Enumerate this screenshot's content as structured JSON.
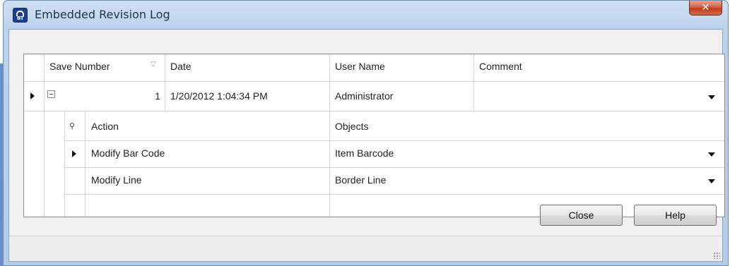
{
  "window": {
    "title": "Embedded Revision Log",
    "icon_text": "BT"
  },
  "grid": {
    "columns": [
      "Save Number",
      "Date",
      "User Name",
      "Comment"
    ],
    "row": {
      "save_number": "1",
      "date": "1/20/2012 1:04:34 PM",
      "user_name": "Administrator",
      "comment": ""
    },
    "detail": {
      "columns": [
        "Action",
        "Objects"
      ],
      "rows": [
        {
          "action": "Modify Bar Code",
          "objects": "Item Barcode"
        },
        {
          "action": "Modify Line",
          "objects": "Border Line"
        }
      ]
    }
  },
  "buttons": {
    "close": "Close",
    "help": "Help"
  },
  "colors": {
    "title_close_button": "#c13a1e",
    "window_frame": "#b3cce8"
  }
}
